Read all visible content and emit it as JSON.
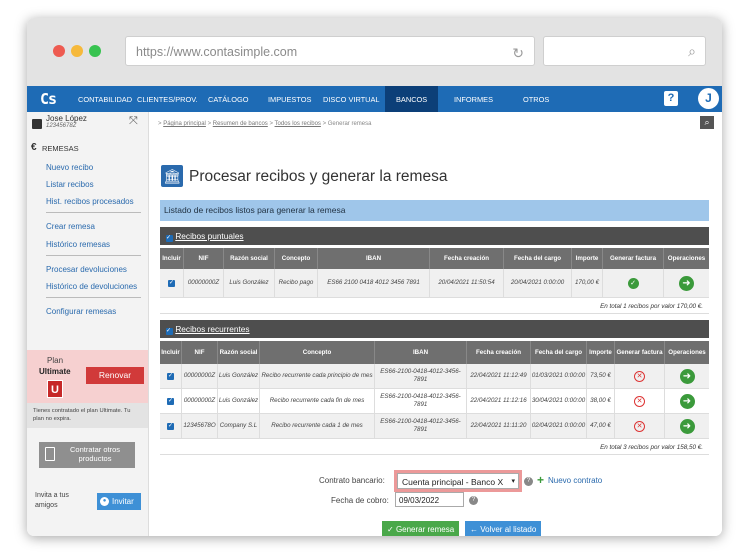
{
  "browser": {
    "url": "https://www.contasimple.com"
  },
  "nav": {
    "logo": "Cs",
    "items": [
      "CONTABILIDAD",
      "CLIENTES/PROV.",
      "CATÁLOGO",
      "IMPUESTOS",
      "DISCO VIRTUAL",
      "BANCOS",
      "INFORMES",
      "OTROS"
    ],
    "active": "BANCOS",
    "help_label": "?",
    "avatar_letter": "J"
  },
  "user": {
    "name": "Jose López",
    "id": "12345678Z"
  },
  "sidebar": {
    "section": "REMESAS",
    "links": [
      "Nuevo recibo",
      "Listar recibos",
      "Hist. recibos procesados",
      "Crear remesa",
      "Histórico remesas",
      "Procesar devoluciones",
      "Histórico de devoluciones",
      "Configurar remesas"
    ],
    "plan_label": "Plan",
    "plan_name": "Ultimate",
    "plan_badge": "U",
    "renew_label": "Renovar",
    "plan_note": "Tienes contratado el plan Ultimate. Tu plan no expira.",
    "contract_label": "Contratar otros productos",
    "invite_text": "Invita a tus amigos",
    "invite_label": "Invitar"
  },
  "breadcrumb": {
    "items": [
      "Página principal",
      "Resumen de bancos",
      "Todos los recibos"
    ],
    "current": "Generar remesa",
    "sep": ">"
  },
  "page": {
    "title": "Procesar recibos y generar la remesa",
    "list_header": "Listado de recibos listos para generar la remesa"
  },
  "puntuales": {
    "title": "Recibos puntuales",
    "headers": [
      "Incluir",
      "NIF",
      "Razón social",
      "Concepto",
      "IBAN",
      "Fecha creación",
      "Fecha del cargo",
      "Importe",
      "Generar factura",
      "Operaciones"
    ],
    "rows": [
      {
        "nif": "00000000Z",
        "razon": "Luis González",
        "concepto": "Recibo pago",
        "iban": "ES66 2100 0418 4012 3456 7891",
        "creacion": "20/04/2021 11:50:54",
        "cargo": "20/04/2021 0:00:00",
        "importe": "170,00 €"
      }
    ],
    "total": "En total 1 recibos por valor 170,00 €."
  },
  "recurrentes": {
    "title": "Recibos recurrentes",
    "headers": [
      "Incluir",
      "NIF",
      "Razón social",
      "Concepto",
      "IBAN",
      "Fecha creación",
      "Fecha del cargo",
      "Importe",
      "Generar factura",
      "Operaciones"
    ],
    "rows": [
      {
        "nif": "00000000Z",
        "razon": "Luis González",
        "concepto": "Recibo recurrente cada principio de mes",
        "iban": "ES66-2100-0418-4012-3456-7891",
        "creacion": "22/04/2021 11:12:49",
        "cargo": "01/03/2021 0:00:00",
        "importe": "73,50 €"
      },
      {
        "nif": "00000000Z",
        "razon": "Luis González",
        "concepto": "Recibo recurrente cada fin de mes",
        "iban": "ES66-2100-0418-4012-3456-7891",
        "creacion": "22/04/2021 11:12:16",
        "cargo": "30/04/2021 0:00:00",
        "importe": "38,00 €"
      },
      {
        "nif": "12345678O",
        "razon": "Company S.L",
        "concepto": "Recibo recurrente cada 1 de mes",
        "iban": "ES66-2100-0418-4012-3456-7891",
        "creacion": "22/04/2021 11:11:20",
        "cargo": "02/04/2021 0:00:00",
        "importe": "47,00 €"
      }
    ],
    "total": "En total 3 recibos por valor 158,50 €."
  },
  "form": {
    "contract_label": "Contrato bancario:",
    "contract_value": "Cuenta principal - Banco X",
    "new_contract": "Nuevo contrato",
    "date_label": "Fecha de cobro:",
    "date_value": "09/03/2022"
  },
  "actions": {
    "generate": "Generar remesa",
    "back": "Volver al listado"
  },
  "colors": {
    "nav": "#1e6bb5",
    "success": "#3b9a3b",
    "danger": "#d13a3a"
  }
}
